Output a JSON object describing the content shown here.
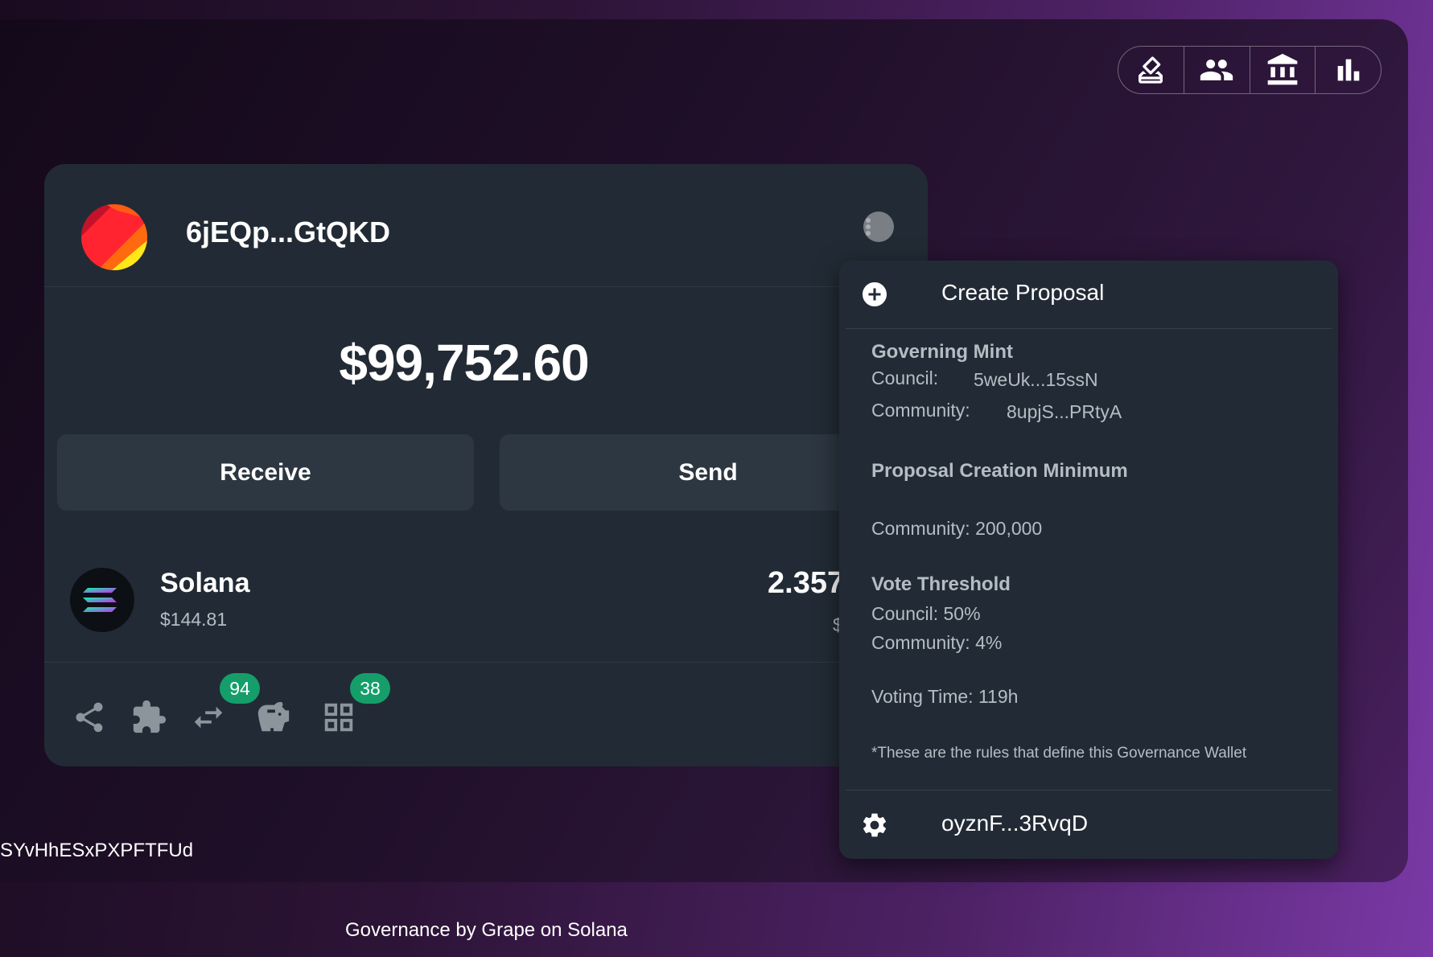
{
  "top_nav": {
    "items": [
      {
        "icon": "ballot-icon"
      },
      {
        "icon": "members-icon"
      },
      {
        "icon": "treasury-icon"
      },
      {
        "icon": "stats-icon"
      }
    ]
  },
  "wallet": {
    "name": "6jEQp...GtQKD",
    "balance": "$99,752.60",
    "receive_label": "Receive",
    "send_label": "Send",
    "token": {
      "name": "Solana",
      "price": "$144.81",
      "amount": "2.357",
      "value": "$"
    },
    "toolbar": {
      "badge_swap": "94",
      "badge_apps": "38"
    }
  },
  "menu": {
    "create_proposal_label": "Create Proposal",
    "governing_mint_title": "Governing Mint",
    "council_label": "Council:",
    "council_value": "5weUk...15ssN",
    "community_label": "Community:",
    "community_value": "8upjS...PRtyA",
    "proposal_min_title": "Proposal Creation Minimum",
    "proposal_min_community": "Community: 200,000",
    "vote_threshold_title": "Vote Threshold",
    "vote_threshold_council": "Council: 50%",
    "vote_threshold_community": "Community: 4%",
    "voting_time": "Voting Time: 119h",
    "rules_note": "*These are the rules that define this Governance Wallet",
    "settings_label": "oyznF...3RvqD"
  },
  "address_fragment": "SYvHhESxPXPFTFUd",
  "footer": "Governance by Grape on Solana",
  "colors": {
    "card_bg": "#222b35",
    "button_bg": "#2d3741",
    "badge_green": "#159e6a",
    "accent_purple": "#7a39a6"
  }
}
